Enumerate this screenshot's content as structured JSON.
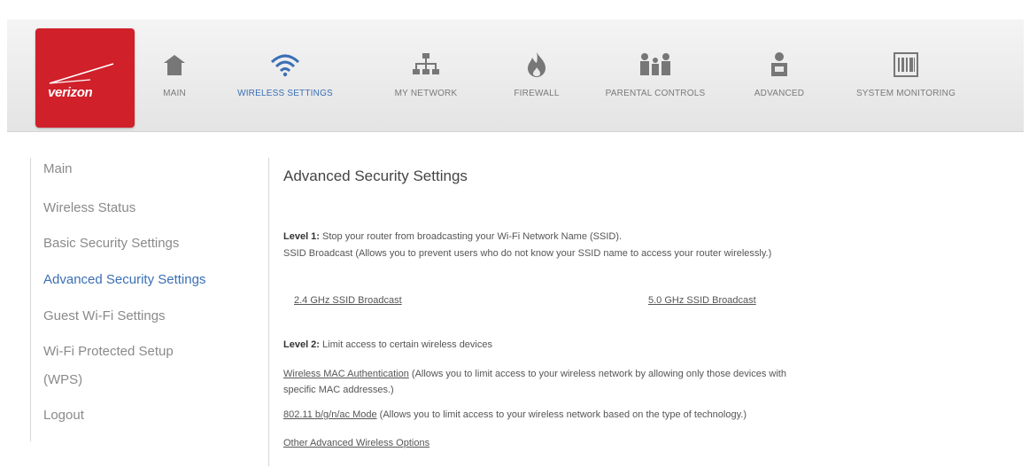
{
  "brand": {
    "name": "verizon"
  },
  "nav": [
    {
      "label": "MAIN",
      "icon": "home-icon"
    },
    {
      "label": "WIRELESS SETTINGS",
      "icon": "wifi-icon",
      "active": true
    },
    {
      "label": "MY NETWORK",
      "icon": "network-icon"
    },
    {
      "label": "FIREWALL",
      "icon": "flame-icon"
    },
    {
      "label": "PARENTAL CONTROLS",
      "icon": "family-icon"
    },
    {
      "label": "ADVANCED",
      "icon": "person-icon"
    },
    {
      "label": "SYSTEM MONITORING",
      "icon": "monitor-icon"
    }
  ],
  "sidebar": {
    "items": [
      {
        "label": "Main"
      },
      {
        "label": "Wireless Status"
      },
      {
        "label": "Basic Security Settings"
      },
      {
        "label": "Advanced Security Settings",
        "active": true
      },
      {
        "label": "Guest Wi-Fi Settings"
      },
      {
        "label": "Wi-Fi Protected Setup"
      },
      {
        "label": "(WPS)"
      },
      {
        "label": "Logout"
      }
    ]
  },
  "main": {
    "title": "Advanced Security Settings",
    "level1": {
      "heading": "Level 1:",
      "text": "Stop your router from broadcasting your Wi-Fi Network Name (SSID).",
      "desc": "SSID Broadcast (Allows you to prevent users who do not know your SSID name to access your router wirelessly.)",
      "link_24": "2.4 GHz SSID Broadcast",
      "link_50": "5.0 GHz SSID Broadcast"
    },
    "level2": {
      "heading": "Level 2:",
      "text": "Limit access to certain wireless devices",
      "mac_link": "Wireless MAC Authentication",
      "mac_desc": "(Allows you to limit access to your wireless network by allowing only those devices with",
      "mac_desc2": "specific MAC addresses.)",
      "mode_link": "802.11 b/g/n/ac Mode",
      "mode_desc": "(Allows you to limit access to your wireless network based on the type of technology.)",
      "other_link": "Other Advanced Wireless Options"
    }
  },
  "colors": {
    "brand_red": "#d0202a",
    "active_blue": "#3a6fb5",
    "nav_text": "#7a7a7a"
  }
}
